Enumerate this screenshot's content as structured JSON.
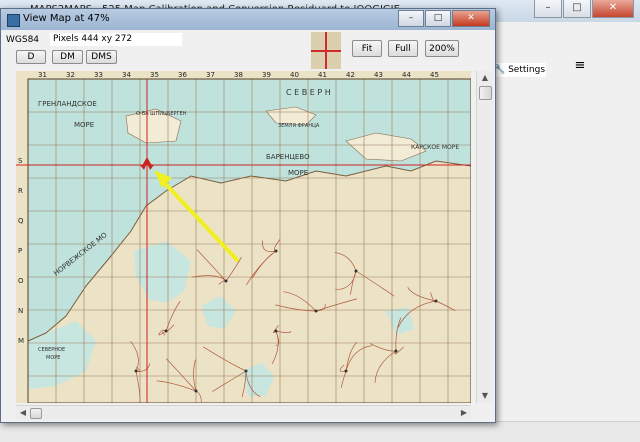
{
  "main_window": {
    "title": "MAPS2MAPS - 525 Map Calibration and Conversion Residuard to JOOGIGIE",
    "settings_label": "Settings",
    "menu_glyph": "≡"
  },
  "map_window": {
    "title": "View Map at 47%",
    "crs": "WGS84",
    "pixels_readout": "Pixels 444 xy 272",
    "buttons": {
      "d": "D",
      "dm": "DM",
      "dms": "DMS",
      "fit": "Fit",
      "full": "Full",
      "zoom200": "200%"
    },
    "controls": {
      "minimize": "–",
      "maximize": "□",
      "close": "✕"
    }
  },
  "map": {
    "top_numbers": [
      "31",
      "32",
      "33",
      "34",
      "35",
      "36",
      "37",
      "38",
      "39",
      "40",
      "41",
      "42",
      "43",
      "44",
      "45"
    ],
    "left_letters": [
      "S",
      "R",
      "Q",
      "P",
      "O",
      "N",
      "M"
    ],
    "labels": {
      "sea_greenland": "ГРЕНЛАНДСКОЕ",
      "sea_greenland2": "МОРЕ",
      "north": "С Е В Е Р Н",
      "barents": "БАРЕНЦЕВО",
      "barents2": "МОРЕ",
      "norwegian": "НОРВЕЖСКОЕ МО",
      "kara": "КАРСКОЕ МОРЕ",
      "svalbard": "О-ВА ШПИЦБЕРГЕН",
      "franz": "ЗЕМЛЯ ФРАНЦА",
      "north_sea": "СЕВЕРНОЕ",
      "north_sea2": "МОРЕ"
    },
    "colors": {
      "sea": "#bfe3dc",
      "land": "#f2ebd5",
      "grid": "#9c7b5a",
      "crosshair": "#cc2222",
      "arrow": "#f0f020"
    }
  }
}
